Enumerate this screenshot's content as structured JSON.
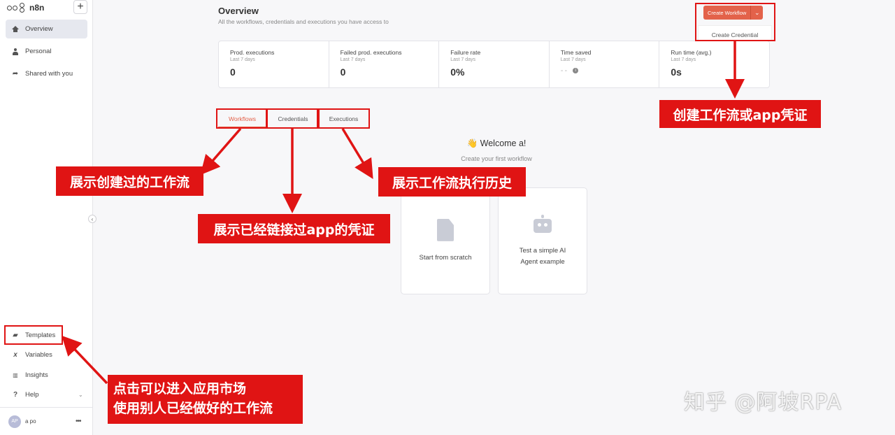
{
  "sidebar": {
    "logo": "n8n",
    "add_label": "+",
    "nav": {
      "overview": "Overview",
      "personal": "Personal",
      "shared": "Shared with you"
    },
    "bottom": {
      "templates": "Templates",
      "variables": "Variables",
      "insights": "Insights",
      "help": "Help"
    },
    "collapse": "‹",
    "user": {
      "initials": "AP",
      "name": "a po",
      "more": "•••"
    }
  },
  "header": {
    "title": "Overview",
    "subtitle": "All the workflows, credentials and executions you have access to",
    "create_workflow": "Create Workflow",
    "dropdown_chevron": "⌄",
    "create_credential": "Create Credential"
  },
  "stats": [
    {
      "label": "Prod. executions",
      "sub": "Last 7 days",
      "value": "0"
    },
    {
      "label": "Failed prod. executions",
      "sub": "Last 7 days",
      "value": "0"
    },
    {
      "label": "Failure rate",
      "sub": "Last 7 days",
      "value": "0%"
    },
    {
      "label": "Time saved",
      "sub": "Last 7 days",
      "value": "--"
    },
    {
      "label": "Run time (avg.)",
      "sub": "Last 7 days",
      "value": "0s"
    }
  ],
  "tabs": [
    "Workflows",
    "Credentials",
    "Executions"
  ],
  "welcome": {
    "wave": "👋",
    "title": "Welcome a!",
    "sub": "Create your first workflow",
    "card1": "Start from scratch",
    "card2_line1": "Test a simple AI",
    "card2_line2": "Agent example"
  },
  "annotations": {
    "create": "创建工作流或app凭证",
    "workflows": "展示创建过的工作流",
    "credentials": "展示已经链接过app的凭证",
    "executions": "展示工作流执行历史",
    "templates_line1": "点击可以进入应用市场",
    "templates_line2": "使用别人已经做好的工作流"
  },
  "watermark": "知乎 @阿坡RPA",
  "colors": {
    "accent": "#e3624a",
    "annotation": "#e01414"
  }
}
